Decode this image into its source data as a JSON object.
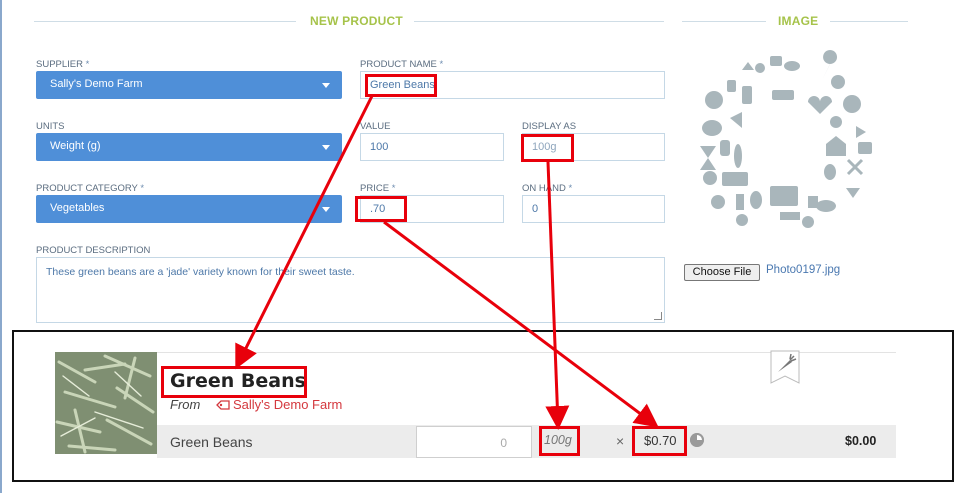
{
  "sections": {
    "new_product": "NEW PRODUCT",
    "image": "IMAGE"
  },
  "form": {
    "supplier": {
      "label": "SUPPLIER",
      "required": "*",
      "value": "Sally's Demo Farm"
    },
    "product_name": {
      "label": "PRODUCT NAME",
      "required": "*",
      "value": "Green Beans"
    },
    "units": {
      "label": "UNITS",
      "value": "Weight (g)"
    },
    "value": {
      "label": "VALUE",
      "value": "100"
    },
    "display_as": {
      "label": "DISPLAY AS",
      "placeholder": "100g"
    },
    "category": {
      "label": "PRODUCT CATEGORY",
      "required": "*",
      "value": "Vegetables"
    },
    "price": {
      "label": "PRICE",
      "required": "*",
      "value": ".70"
    },
    "on_hand": {
      "label": "ON HAND",
      "required": "*",
      "value": "0"
    },
    "description": {
      "label": "PRODUCT DESCRIPTION",
      "value": "These green beans are a 'jade' variety known for their sweet taste."
    }
  },
  "image_panel": {
    "choose_button": "Choose File",
    "file_name": "Photo0197.jpg"
  },
  "preview": {
    "product_name": "Green Beans",
    "from_label": "From",
    "supplier": "Sally's Demo Farm",
    "row_name": "Green Beans",
    "quantity": "0",
    "display": "100g",
    "times": "×",
    "price": "$0.70",
    "total": "$0.00"
  },
  "colors": {
    "accent_green": "#a6c34a",
    "select_blue": "#4f8fd8",
    "annotation_red": "#e8000b",
    "supplier_red": "#d4383e"
  }
}
